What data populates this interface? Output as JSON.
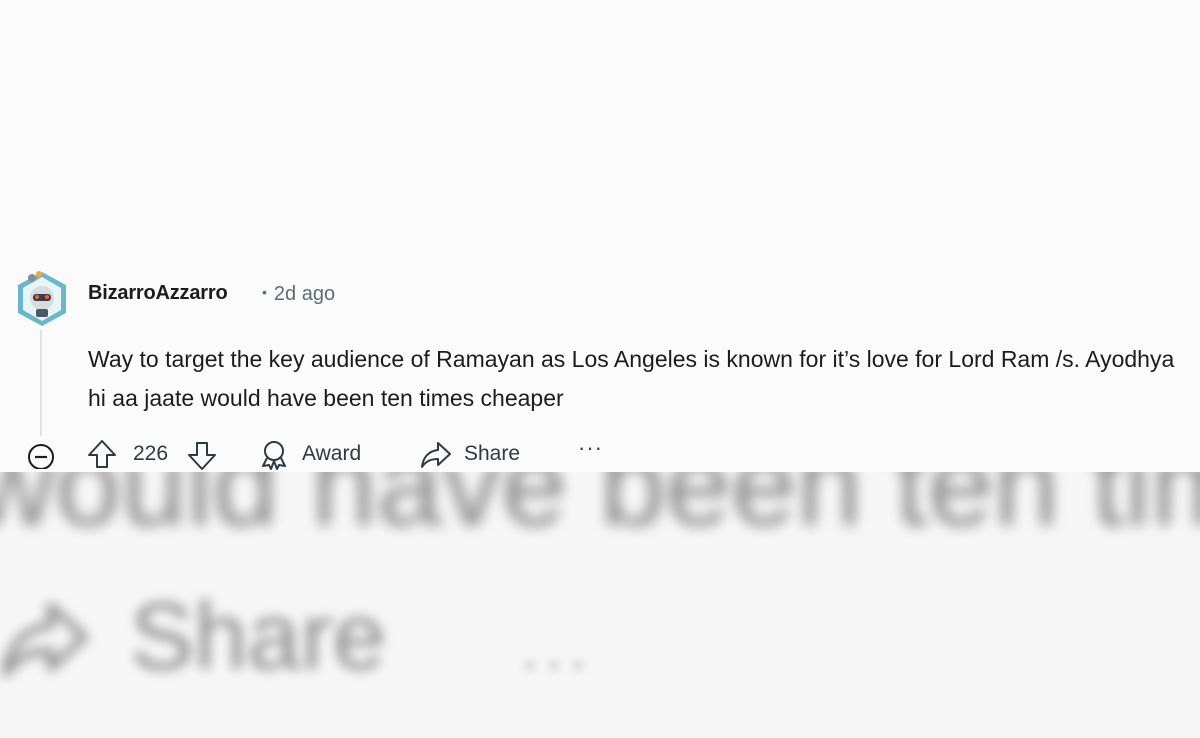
{
  "comment": {
    "author": "BizarroAzzarro",
    "separator": "•",
    "time_ago": "2d ago",
    "body": "Way to target the key audience of Ramayan as Los Angeles is known for it’s love for Lord Ram /s. Ayodhya hi aa jaate would have been ten times cheaper",
    "avatar_icon": "snoo-avatar-icon"
  },
  "actions": {
    "collapse_icon": "minus-circle-icon",
    "upvote_icon": "arrow-up-icon",
    "score": "226",
    "downvote_icon": "arrow-down-icon",
    "award_label": "Award",
    "award_icon": "award-icon",
    "share_label": "Share",
    "share_icon": "share-arrow-icon",
    "more_label": "···"
  },
  "background_zoom": {
    "text": "would have been ten times ch",
    "share_label": "Share",
    "more_label": "···"
  },
  "colors": {
    "text": "#1c1c1c",
    "meta": "#576f76",
    "action": "#2a3c42",
    "thread_line": "#e1e3e6"
  }
}
